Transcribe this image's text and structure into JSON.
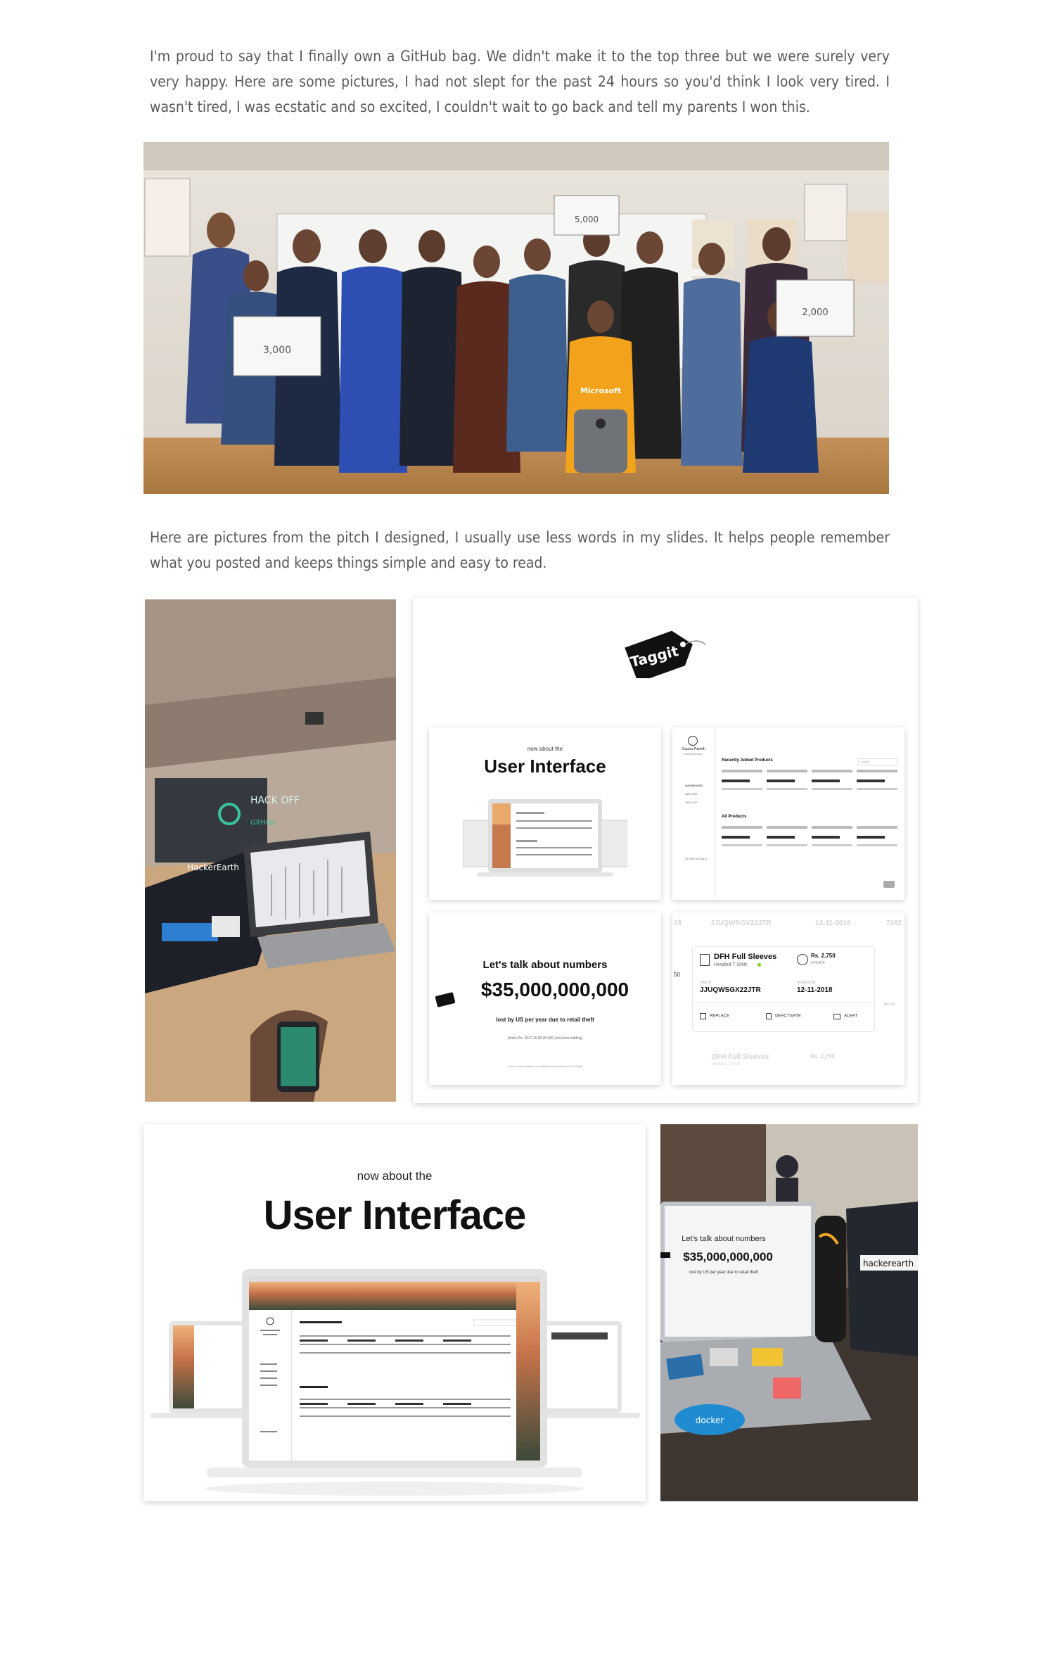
{
  "paragraphs": [
    "I'm proud to say that I finally own a GitHub bag. We didn't make it to the top three but we were surely very very happy. Here are some pictures, I had not slept for the past 24 hours so you'd think I look very tired. I wasn't tired, I was ecstatic and so excited, I couldn't wait to go back and tell my parents I won this.",
    "Here are pictures from the pitch I designed, I usually use less words in my slides. It helps people remember what you posted and keeps things simple and easy to read."
  ],
  "group_photo": {
    "certificates": [
      "3,000",
      "5,000",
      "2,000"
    ],
    "shirt_text": "Microsoft"
  },
  "event_photo": {
    "banner_title": "HACK OFF",
    "banner_sub": "GitHub",
    "shirt_text": "HackerEarth"
  },
  "pitch_collage": {
    "logo_text": "Taggit",
    "ui_slide": {
      "kicker": "now about the",
      "title": "User Interface"
    },
    "dashboard": {
      "user_name": "Gaurav Ramith",
      "user_role": "Brand Manager",
      "menu": [
        "DASHBOARD",
        "ADD TAG",
        "TAG LIST",
        "STORE DETAILS"
      ],
      "section_recent": "Recently Added Products",
      "section_all": "All Products",
      "search_placeholder": "Search"
    },
    "numbers_slide": {
      "title": "Let's talk about numbers",
      "amount": "$35,000,000,000",
      "caption": "lost by US per year due to retail theft",
      "conversion": "(that's Rs. 2517,20,00,00,000 (not even kidding)",
      "source": "source: www.statista.com/statistics/retail-theft-usa-2018.pdf"
    },
    "product_card": {
      "name": "DFH Full Sleeves",
      "type": "Hooded T-Shirt",
      "price": "Rs. 2,750",
      "status": "UPDATE",
      "tag_id_label": "TAG ID",
      "tag_id": "JJUQWSGX22JTR",
      "added_label": "ADDED ON",
      "added_on": "12-11-2018",
      "actions": [
        "REPLACE",
        "DEACTIVATE",
        "ALERT"
      ],
      "ghost_left_tag": "18",
      "ghost_right_id": "7282",
      "ghost_right_label": "TAG ID",
      "ghost_left_num": "50"
    }
  },
  "ui_large": {
    "kicker": "now about the",
    "title": "User Interface"
  },
  "laptop_photo": {
    "screen_title": "Let's talk about numbers",
    "screen_amount": "$35,000,000,000",
    "screen_caption": "lost by US per year due to retail theft",
    "sticker": "docker",
    "shirt_text": "hackerearth"
  },
  "colors": {
    "text": "#5a5a5a",
    "accent_orange": "#f5a623",
    "dark": "#111111"
  }
}
